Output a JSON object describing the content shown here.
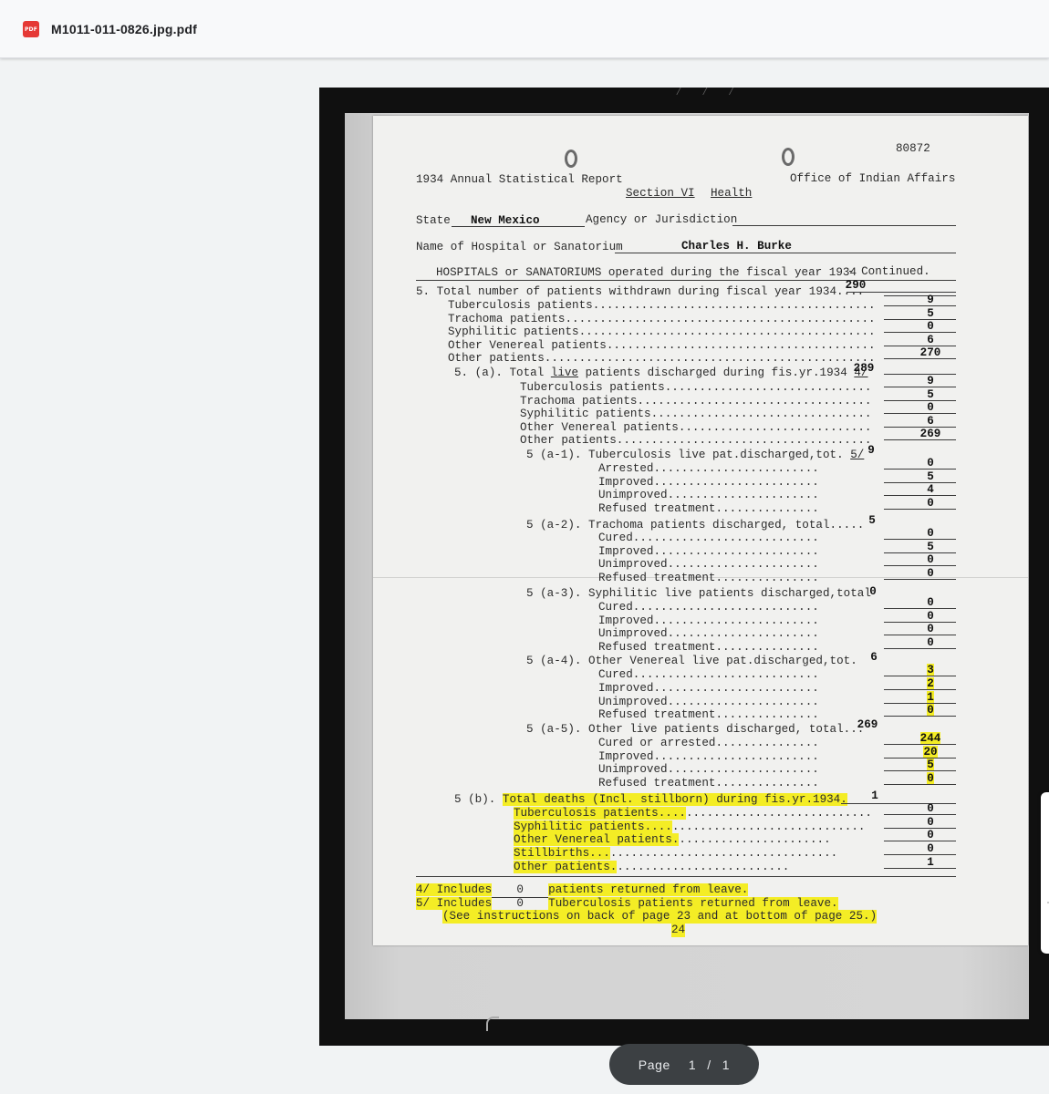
{
  "viewer": {
    "file_icon": "PDF",
    "file_name": "M1011-011-0826.jpg.pdf",
    "page_label": "Page",
    "current_page": "1",
    "page_separator": "/",
    "total_pages": "1"
  },
  "document": {
    "doc_number": "80872",
    "title_left": "1934 Annual Statistical Report",
    "title_right": "Office of Indian Affairs",
    "section": "Section VI",
    "section_topic": "Health",
    "state_label": "State",
    "state_value": "New Mexico",
    "agency_label": "Agency or Jurisdiction",
    "hospital_label": "Name of Hospital or Sanatorium",
    "hospital_value": "Charles H. Burke",
    "heading": "HOSPITALS or SANATORIUMS operated during the fiscal year 1934",
    "heading_cont": "- Continued.",
    "l5": "5. Total number of patients withdrawn during fiscal year 1934....",
    "l5_total": "290",
    "l5_items": [
      "Tuberculosis patients.........................................",
      "Trachoma patients.............................................",
      "Syphilitic patients...........................................",
      "Other Venereal patients.......................................",
      "Other patients................................................"
    ],
    "l5_values": [
      "9",
      "5",
      "0",
      "6",
      "270"
    ],
    "l5a_pre": "5. (a). Total ",
    "l5a_live": "live",
    "l5a_post": " patients discharged during fis.yr.1934 ",
    "l5a_note": "4/",
    "l5a_total": "289",
    "l5a_items": [
      "Tuberculosis patients..............................",
      "Trachoma patients..................................",
      "Syphilitic patients................................",
      "Other Venereal patients............................",
      "Other patients....................................."
    ],
    "l5a_values": [
      "9",
      "5",
      "0",
      "6",
      "269"
    ],
    "l5a1": "5 (a-1). Tuberculosis live pat.discharged,tot.",
    "l5a1_note": "5/",
    "l5a1_total": "9",
    "l5a1_items": [
      "Arrested........................",
      "Improved........................",
      "Unimproved......................",
      "Refused treatment..............."
    ],
    "l5a1_values": [
      "0",
      "5",
      "4",
      "0"
    ],
    "l5a2": "5 (a-2). Trachoma patients discharged, total.....",
    "l5a2_total": "5",
    "l5a2_items": [
      "Cured...........................",
      "Improved........................",
      "Unimproved......................",
      "Refused treatment..............."
    ],
    "l5a2_values": [
      "0",
      "5",
      "0",
      "0"
    ],
    "l5a3": "5 (a-3). Syphilitic live patients discharged,total",
    "l5a3_total": "0",
    "l5a3_items": [
      "Cured...........................",
      "Improved........................",
      "Unimproved......................",
      "Refused treatment..............."
    ],
    "l5a3_values": [
      "0",
      "0",
      "0",
      "0"
    ],
    "l5a4": "5 (a-4). Other Venereal live pat.discharged,tot.",
    "l5a4_total": "6",
    "l5a4_items": [
      "Cured...........................",
      "Improved........................",
      "Unimproved......................",
      "Refused treatment..............."
    ],
    "l5a4_values": [
      "3",
      "2",
      "1",
      "0"
    ],
    "l5a5": "5 (a-5). Other live patients discharged, total...",
    "l5a5_total": "269",
    "l5a5_items": [
      "Cured or arrested...............",
      "Improved........................",
      "Unimproved......................",
      "Refused treatment..............."
    ],
    "l5a5_values": [
      "244",
      "20",
      "5",
      "0"
    ],
    "l5b_num": "5 (b).",
    "l5b": "Total deaths (Incl. stillborn) during fis.yr.1934.",
    "l5b_total": "1",
    "l5b_items": [
      "Tuberculosis patients....",
      "Syphilitic patients....",
      "Other Venereal patients.",
      "Stillbirths...",
      "Other patients."
    ],
    "l5b_dots": [
      "...........................",
      "............................",
      "......................",
      ".................................",
      "........................."
    ],
    "l5b_values": [
      "0",
      "0",
      "0",
      "0",
      "1"
    ],
    "fn4_a": "4/ Includes",
    "fn4_v": "0",
    "fn4_b": "patients returned from leave.",
    "fn5_a": "5/ Includes",
    "fn5_v": "0",
    "fn5_b": "Tuberculosis patients returned from leave.",
    "fn_note": "(See instructions on back of page 23 and at bottom of page 25.)",
    "page_number": "24"
  },
  "colors": {
    "highlight": "#f4ed25",
    "pill_bg": "#3c4043",
    "pdf_icon": "#e53935"
  }
}
